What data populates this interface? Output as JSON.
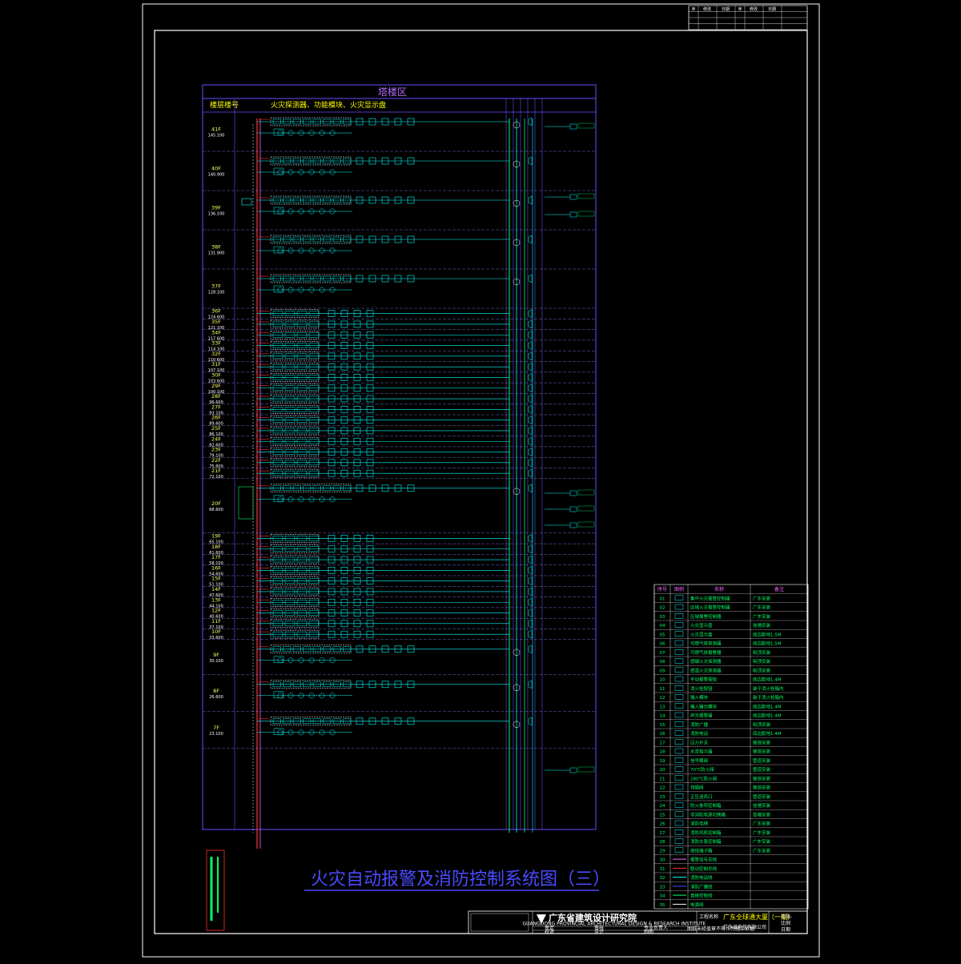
{
  "drawing": {
    "title": "火灾自动报警及消防控制系统图（三）",
    "zone_label": "塔楼区",
    "column_headers": {
      "floor": "楼层楼号",
      "devices": "火灾探测器、功能模块、火灾显示盘"
    }
  },
  "floors": [
    {
      "name": "41F",
      "elev": "145.100"
    },
    {
      "name": "40F",
      "elev": "140.900"
    },
    {
      "name": "39F",
      "elev": "136.100"
    },
    {
      "name": "38F",
      "elev": "131.900"
    },
    {
      "name": "37F",
      "elev": "128.100"
    },
    {
      "name": "36F",
      "elev": "124.600"
    },
    {
      "name": "35F",
      "elev": "121.100"
    },
    {
      "name": "34F",
      "elev": "117.600"
    },
    {
      "name": "33F",
      "elev": "114.100"
    },
    {
      "name": "32F",
      "elev": "110.600"
    },
    {
      "name": "31F",
      "elev": "107.100"
    },
    {
      "name": "30F",
      "elev": "103.600"
    },
    {
      "name": "29F",
      "elev": "100.100"
    },
    {
      "name": "28F",
      "elev": "96.600"
    },
    {
      "name": "27F",
      "elev": "93.100"
    },
    {
      "name": "26F",
      "elev": "89.600"
    },
    {
      "name": "25F",
      "elev": "86.100"
    },
    {
      "name": "24F",
      "elev": "82.600"
    },
    {
      "name": "23F",
      "elev": "79.100"
    },
    {
      "name": "22F",
      "elev": "75.600"
    },
    {
      "name": "21F",
      "elev": "72.100"
    },
    {
      "name": "20F",
      "elev": "68.600"
    },
    {
      "name": "19F",
      "elev": "65.100"
    },
    {
      "name": "18F",
      "elev": "61.600"
    },
    {
      "name": "17F",
      "elev": "58.100"
    },
    {
      "name": "16F",
      "elev": "54.600"
    },
    {
      "name": "15F",
      "elev": "51.100"
    },
    {
      "name": "14F",
      "elev": "47.600"
    },
    {
      "name": "13F",
      "elev": "44.100"
    },
    {
      "name": "12F",
      "elev": "40.600"
    },
    {
      "name": "11F",
      "elev": "37.100"
    },
    {
      "name": "10F",
      "elev": "33.600"
    },
    {
      "name": "9F",
      "elev": "30.100"
    },
    {
      "name": "8F",
      "elev": "26.600"
    },
    {
      "name": "7F",
      "elev": "23.100"
    }
  ],
  "legend": {
    "headers": [
      "序号",
      "图例",
      "名称",
      "备注"
    ],
    "rows": [
      {
        "no": "01",
        "name": "集中火灾报警控制器",
        "note": "广东安装"
      },
      {
        "no": "02",
        "name": "区域火灾报警控制器",
        "note": "广东安装"
      },
      {
        "no": "03",
        "name": "区域报警控制器",
        "note": "广东安装"
      },
      {
        "no": "04",
        "name": "火灾显示盘",
        "note": "挂墙安装"
      },
      {
        "no": "05",
        "name": "火灾显示盘",
        "note": "底边距地1.5M"
      },
      {
        "no": "06",
        "name": "可燃气体探测器",
        "note": "底边距地1.5M"
      },
      {
        "no": "07",
        "name": "可燃气体报警器",
        "note": "吸顶安装"
      },
      {
        "no": "08",
        "name": "感烟火灾探测器",
        "note": "吸顶安装"
      },
      {
        "no": "09",
        "name": "感温火灾探测器",
        "note": "吸顶安装"
      },
      {
        "no": "10",
        "name": "手动报警按钮",
        "note": "底边距地1.4M"
      },
      {
        "no": "11",
        "name": "消火栓按钮",
        "note": "装于消火栓箱内"
      },
      {
        "no": "12",
        "name": "输入模块",
        "note": "装于消火栓箱内"
      },
      {
        "no": "13",
        "name": "输入输出模块",
        "note": "底边距地1.4M"
      },
      {
        "no": "14",
        "name": "声光报警器",
        "note": "底边距地1.4M"
      },
      {
        "no": "15",
        "name": "消防广播",
        "note": "吸顶安装"
      },
      {
        "no": "16",
        "name": "消防电话",
        "note": "底边距地1.4M"
      },
      {
        "no": "17",
        "name": "压力开关",
        "note": "管道安装"
      },
      {
        "no": "18",
        "name": "水流指示器",
        "note": "管道安装"
      },
      {
        "no": "19",
        "name": "信号蝶阀",
        "note": "管道安装"
      },
      {
        "no": "20",
        "name": "70℃防火阀",
        "note": "管道安装"
      },
      {
        "no": "21",
        "name": "280℃防火阀",
        "note": "管道安装"
      },
      {
        "no": "22",
        "name": "排烟阀",
        "note": "管道安装"
      },
      {
        "no": "23",
        "name": "正压送风口",
        "note": "管道安装"
      },
      {
        "no": "24",
        "name": "防火卷帘控制箱",
        "note": "挂墙安装"
      },
      {
        "no": "25",
        "name": "非消防电源切换箱",
        "note": "挂墙安装"
      },
      {
        "no": "26",
        "name": "消防电梯",
        "note": "广东安装"
      },
      {
        "no": "27",
        "name": "消防风机控制箱",
        "note": "广东安装"
      },
      {
        "no": "28",
        "name": "消防水泵控制箱",
        "note": "广东安装"
      },
      {
        "no": "29",
        "name": "接线端子箱",
        "note": "广东安装"
      },
      {
        "no": "30",
        "name": "报警信号总线",
        "note": ""
      },
      {
        "no": "31",
        "name": "联动控制总线",
        "note": ""
      },
      {
        "no": "32",
        "name": "消防电话线",
        "note": ""
      },
      {
        "no": "33",
        "name": "消防广播线",
        "note": ""
      },
      {
        "no": "34",
        "name": "直接控制线",
        "note": ""
      },
      {
        "no": "35",
        "name": "电源线",
        "note": ""
      }
    ]
  },
  "title_block": {
    "org_name": "广东省建筑设计研究院",
    "org_name_en": "GUANGDONG PROVINCIAL ARCHITECTURAL DESIGN & RESEARCH INSTITUTE",
    "project_label": "工程名称",
    "project_name": "广东全球通大厦（一期）",
    "client": "广东省电信有限公司",
    "rows": [
      "审定",
      "审核",
      "专业负责人",
      "校对",
      "设计",
      "制图"
    ],
    "drawing_no": "电施-",
    "scale": "比例",
    "date": "日期"
  },
  "revision_table": {
    "headers": [
      "序",
      "修改",
      "日期",
      "序",
      "修改",
      "日期"
    ]
  },
  "notes": "图纸未经盖章不得作为施工依据"
}
